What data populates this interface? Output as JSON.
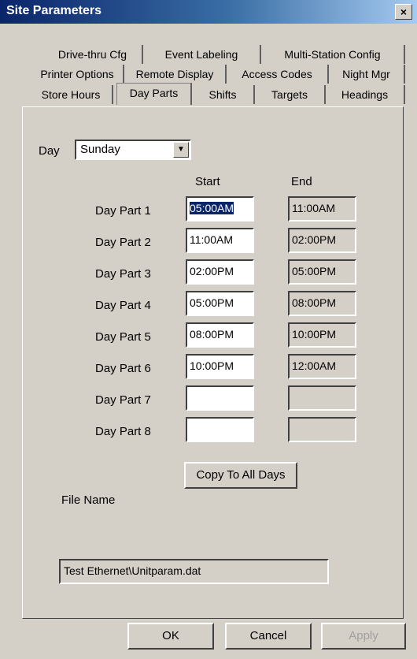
{
  "window": {
    "title": "Site Parameters",
    "close_glyph": "×"
  },
  "tabs": {
    "row1": [
      "Drive-thru Cfg",
      "Event Labeling",
      "Multi-Station Config"
    ],
    "row2": [
      "Printer Options",
      "Remote Display",
      "Access Codes",
      "Night Mgr"
    ],
    "row3": [
      "Store Hours",
      "Day Parts",
      "Shifts",
      "Targets",
      "Headings"
    ],
    "active": "Day Parts"
  },
  "day": {
    "label": "Day",
    "selected": "Sunday"
  },
  "columns": {
    "start": "Start",
    "end": "End"
  },
  "day_parts": [
    {
      "label": "Day Part 1",
      "start": "05:00AM",
      "end": "11:00AM"
    },
    {
      "label": "Day Part 2",
      "start": "11:00AM",
      "end": "02:00PM"
    },
    {
      "label": "Day Part 3",
      "start": "02:00PM",
      "end": "05:00PM"
    },
    {
      "label": "Day Part 4",
      "start": "05:00PM",
      "end": "08:00PM"
    },
    {
      "label": "Day Part 5",
      "start": "08:00PM",
      "end": "10:00PM"
    },
    {
      "label": "Day Part 6",
      "start": "10:00PM",
      "end": "12:00AM"
    },
    {
      "label": "Day Part 7",
      "start": "",
      "end": ""
    },
    {
      "label": "Day Part 8",
      "start": "",
      "end": ""
    }
  ],
  "copy_button": "Copy To All Days",
  "file": {
    "label": "File Name",
    "value": "Test Ethernet\\Unitparam.dat"
  },
  "buttons": {
    "ok": "OK",
    "cancel": "Cancel",
    "apply": "Apply"
  }
}
